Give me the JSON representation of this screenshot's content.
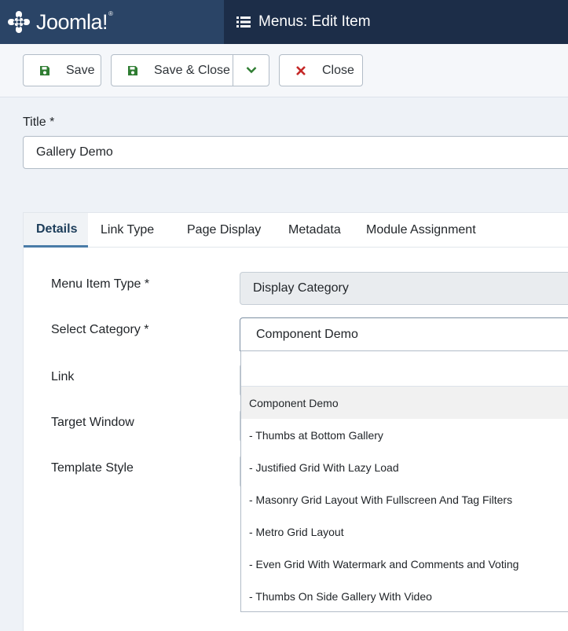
{
  "header": {
    "brand": "Joomla!",
    "brand_trademark": "®",
    "page_title": "Menus: Edit Item",
    "icons": {
      "logo": "joomla-logo",
      "title": "list-icon"
    }
  },
  "toolbar": {
    "save_label": "Save",
    "save_close_label": "Save & Close",
    "close_label": "Close",
    "colors": {
      "save_icon": "#2f7d32",
      "close_icon": "#c52827"
    }
  },
  "form": {
    "title_label": "Title *",
    "title_value": "Gallery Demo"
  },
  "tabs": [
    "Details",
    "Link Type",
    "Page Display",
    "Metadata",
    "Module Assignment"
  ],
  "fields": {
    "menu_item_type": {
      "label": "Menu Item Type *",
      "value": "Display Category"
    },
    "select_category": {
      "label": "Select Category *",
      "value": "Component Demo"
    },
    "link": {
      "label": "Link"
    },
    "target_window": {
      "label": "Target Window"
    },
    "template_style": {
      "label": "Template Style"
    }
  },
  "dropdown": {
    "options": [
      "Component Demo",
      "- Thumbs at Bottom Gallery",
      "- Justified Grid With Lazy Load",
      "- Masonry Grid Layout With Fullscreen And Tag Filters",
      "- Metro Grid Layout",
      "- Even Grid With Watermark and Comments and Voting",
      "- Thumbs On Side Gallery With Video"
    ],
    "highlighted_index": 0
  }
}
